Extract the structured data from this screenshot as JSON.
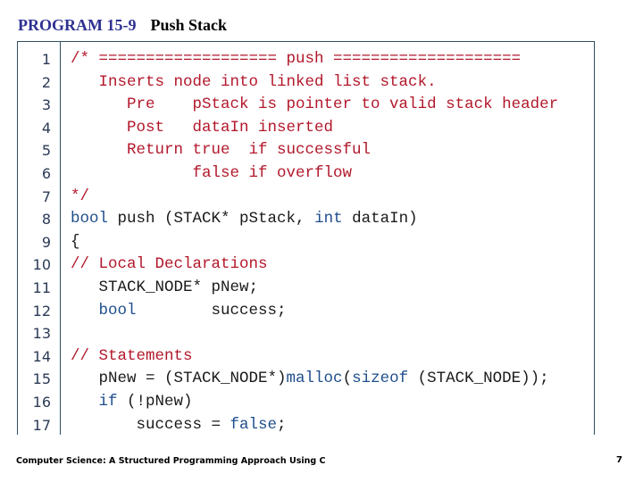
{
  "title": {
    "program_label": "PROGRAM 15-9",
    "program_name": "Push Stack"
  },
  "colors": {
    "title_label": "#2e3192",
    "comment": "#b2182b",
    "keyword": "#1f4e8c",
    "plain": "#1a1a1a",
    "frame_border": "#2f4f5f"
  },
  "code": {
    "lines": [
      {
        "num": "1",
        "tokens": [
          {
            "t": "comment",
            "v": "/* =================== push ===================="
          }
        ]
      },
      {
        "num": "2",
        "tokens": [
          {
            "t": "comment",
            "v": "   Inserts node into linked list stack."
          }
        ]
      },
      {
        "num": "3",
        "tokens": [
          {
            "t": "comment",
            "v": "      Pre    pStack is pointer to valid stack header"
          }
        ]
      },
      {
        "num": "4",
        "tokens": [
          {
            "t": "comment",
            "v": "      Post   dataIn inserted"
          }
        ]
      },
      {
        "num": "5",
        "tokens": [
          {
            "t": "comment",
            "v": "      Return true  if successful"
          }
        ]
      },
      {
        "num": "6",
        "tokens": [
          {
            "t": "comment",
            "v": "             false if overflow"
          }
        ]
      },
      {
        "num": "7",
        "tokens": [
          {
            "t": "comment",
            "v": "*/"
          }
        ]
      },
      {
        "num": "8",
        "tokens": [
          {
            "t": "keyword",
            "v": "bool"
          },
          {
            "t": "plain",
            "v": " push (STACK* pStack, "
          },
          {
            "t": "keyword",
            "v": "int"
          },
          {
            "t": "plain",
            "v": " dataIn)"
          }
        ]
      },
      {
        "num": "9",
        "tokens": [
          {
            "t": "plain",
            "v": "{"
          }
        ]
      },
      {
        "num": "10",
        "tokens": [
          {
            "t": "comment",
            "v": "// Local Declarations"
          }
        ]
      },
      {
        "num": "11",
        "tokens": [
          {
            "t": "plain",
            "v": "   STACK_NODE* pNew;"
          }
        ]
      },
      {
        "num": "12",
        "tokens": [
          {
            "t": "plain",
            "v": "   "
          },
          {
            "t": "keyword",
            "v": "bool"
          },
          {
            "t": "plain",
            "v": "        success;"
          }
        ]
      },
      {
        "num": "13",
        "tokens": [
          {
            "t": "plain",
            "v": ""
          }
        ]
      },
      {
        "num": "14",
        "tokens": [
          {
            "t": "comment",
            "v": "// Statements"
          }
        ]
      },
      {
        "num": "15",
        "tokens": [
          {
            "t": "plain",
            "v": "   pNew = (STACK_NODE*)"
          },
          {
            "t": "keyword",
            "v": "malloc"
          },
          {
            "t": "plain",
            "v": "("
          },
          {
            "t": "keyword",
            "v": "sizeof"
          },
          {
            "t": "plain",
            "v": " (STACK_NODE));"
          }
        ]
      },
      {
        "num": "16",
        "tokens": [
          {
            "t": "plain",
            "v": "   "
          },
          {
            "t": "keyword",
            "v": "if"
          },
          {
            "t": "plain",
            "v": " (!pNew)"
          }
        ]
      },
      {
        "num": "17",
        "tokens": [
          {
            "t": "plain",
            "v": "       success = "
          },
          {
            "t": "keyword",
            "v": "false"
          },
          {
            "t": "plain",
            "v": ";"
          }
        ]
      }
    ]
  },
  "footer": {
    "book_title": "Computer Science: A Structured Programming Approach Using C",
    "page_number": "7"
  }
}
